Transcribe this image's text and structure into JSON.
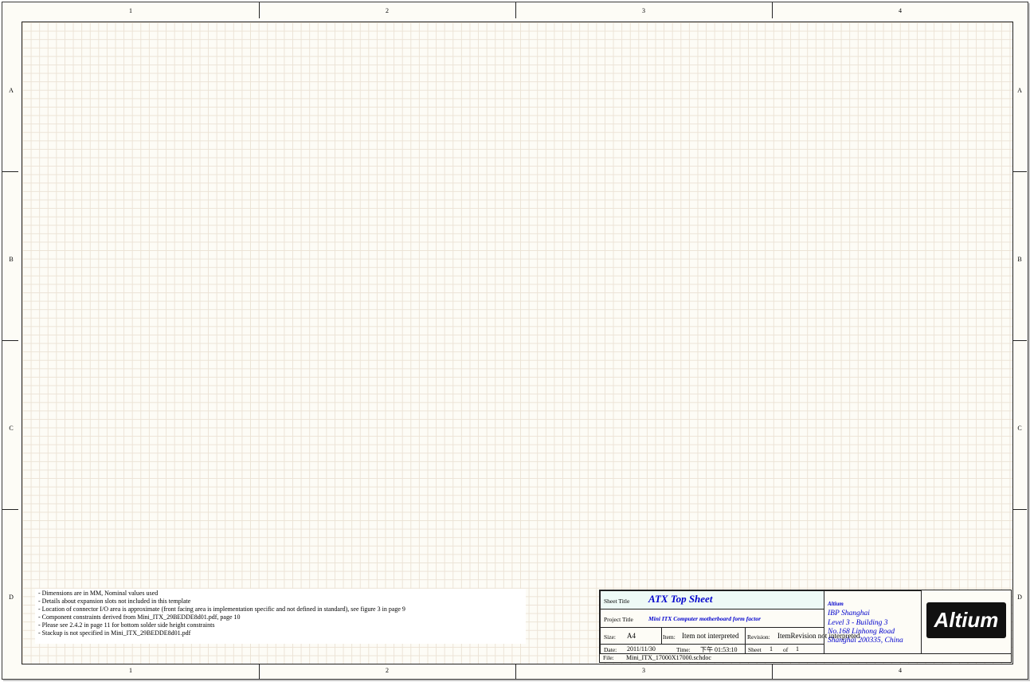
{
  "zones": {
    "columns": [
      "1",
      "2",
      "3",
      "4"
    ],
    "rows": [
      "A",
      "B",
      "C",
      "D"
    ]
  },
  "notes": [
    "- Dimensions are in MM, Nominal values used",
    "- Details about expansion slots not included in this template",
    "- Location of connector I/O area is approximate (front facing area is implementation specific and not defined in standard), see figure 3 in page 9",
    "- Component constraints derived from Mini_ITX_29BEDDE8d01.pdf, page 10",
    "- Please see 2.4.2 in page 11 for bottom solder side height constraints",
    "- Stackup is not specified in Mini_ITX_29BEDDE8d01.pdf"
  ],
  "title_block": {
    "sheet_title_label": "Sheet Title",
    "sheet_title": "ATX Top Sheet",
    "project_title_label": "Project Title",
    "project_title": "Mini ITX Computer motherboard form factor",
    "size_label": "Size:",
    "size": "A4",
    "item_label": "Item:",
    "item": "Item not interpreted",
    "revision_label": "Revision:",
    "revision": "ItemRevision not interpreted",
    "date_label": "Date:",
    "date": "2011/11/30",
    "time_label": "Time:",
    "time": "下午 01:53:10",
    "sheet_label": "Sheet",
    "sheet_num": "1",
    "of_label": "of",
    "sheet_total": "1",
    "file_label": "File:",
    "file": "Mini_ITX_17000X17000.schdoc",
    "company": "Altium",
    "address": [
      "IBP Shanghai",
      "Level 3 - Building 3",
      "No.168 Linhong Road",
      "Shanghai 200335, China"
    ],
    "logo": "Altium"
  },
  "colors": {
    "accent_blue": "#0000cc",
    "sheet_bg": "#fdfcf6",
    "title_fill": "#eefaf6"
  }
}
